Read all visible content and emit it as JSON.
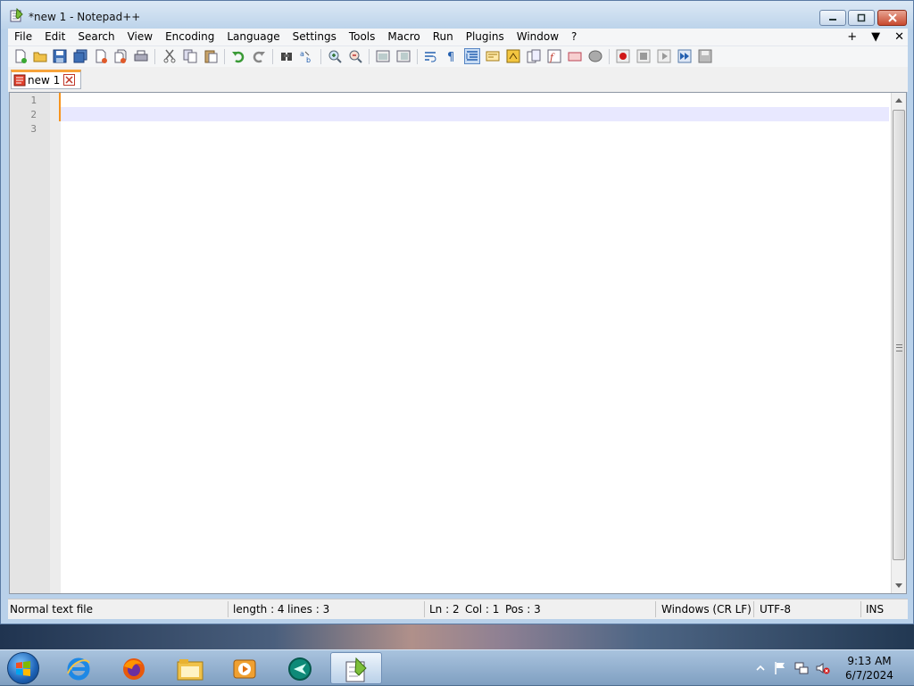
{
  "window": {
    "title": "*new 1 - Notepad++"
  },
  "menu": {
    "items": [
      "File",
      "Edit",
      "Search",
      "View",
      "Encoding",
      "Language",
      "Settings",
      "Tools",
      "Macro",
      "Run",
      "Plugins",
      "Window",
      "?"
    ],
    "right": {
      "plus": "+",
      "down": "▼",
      "close": "✕"
    }
  },
  "tabs": [
    {
      "label": "new 1",
      "modified": true
    }
  ],
  "editor": {
    "line_numbers": [
      "1",
      "2",
      "3"
    ],
    "current_line": 2
  },
  "status": {
    "file_type": "Normal text file",
    "length": "length : 4",
    "lines": "lines : 3",
    "ln": "Ln : 2",
    "col": "Col : 1",
    "pos": "Pos : 3",
    "eol": "Windows (CR LF)",
    "encoding": "UTF-8",
    "mode": "INS"
  },
  "taskbar": {
    "apps": [
      "internet-explorer",
      "firefox",
      "file-explorer",
      "media-player",
      "teamviewer",
      "notepad-plus-plus"
    ],
    "active_app": "notepad-plus-plus",
    "clock_time": "9:13 AM",
    "clock_date": "6/7/2024"
  },
  "colors": {
    "caret": "#f7941d",
    "tab_accent": "#f7a33a",
    "current_line": "#e8e8ff"
  }
}
